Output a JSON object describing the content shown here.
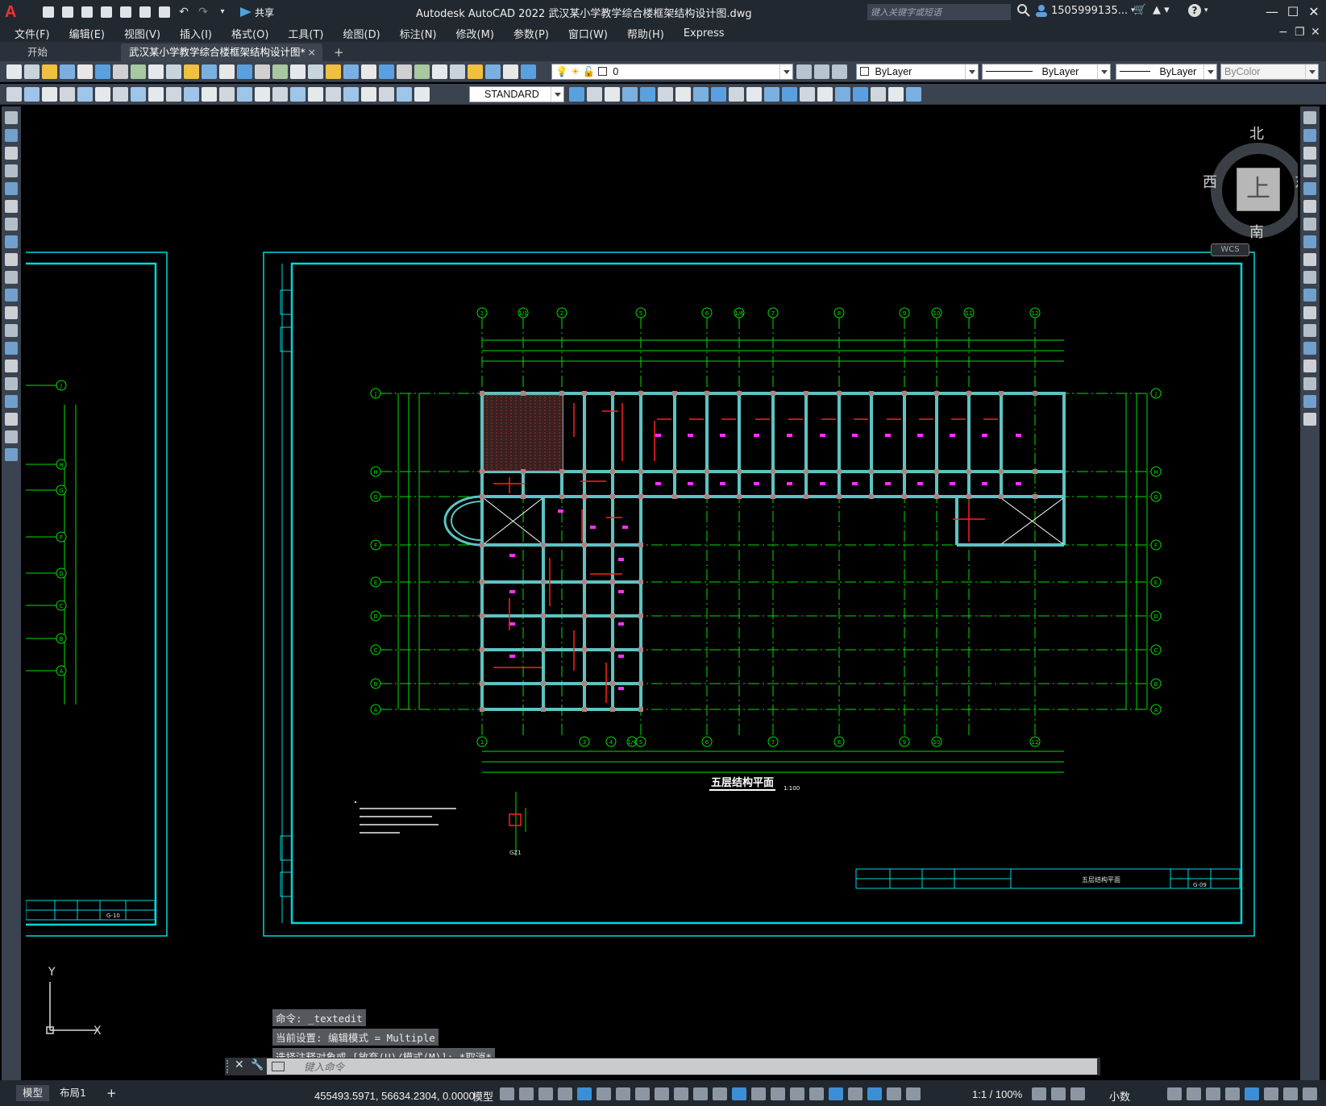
{
  "app": {
    "logo": "A",
    "title": "Autodesk AutoCAD 2022    武汉某小学教学综合楼框架结构设计图.dwg",
    "share_label": "共享",
    "search_placeholder": "键入关键字或短语",
    "user": "1505999135...",
    "help": "?"
  },
  "menu": [
    "文件(F)",
    "编辑(E)",
    "视图(V)",
    "插入(I)",
    "格式(O)",
    "工具(T)",
    "绘图(D)",
    "标注(N)",
    "修改(M)",
    "参数(P)",
    "窗口(W)",
    "帮助(H)",
    "Express"
  ],
  "tabs": {
    "start": "开始",
    "active": "武汉某小学教学综合楼框架结构设计图*",
    "close": "×",
    "add": "+"
  },
  "toolbar": {
    "layer_value": "0",
    "color": "ByLayer",
    "linetype": "ByLayer",
    "lineweight": "ByLayer",
    "plotstyle": "ByColor",
    "text_style": "STANDARD"
  },
  "viewcube": {
    "north": "北",
    "south": "南",
    "east": "东",
    "west": "西",
    "top_face": "上",
    "wcs": "WCS"
  },
  "drawing": {
    "plan_title": "五层结构平面",
    "scale": "1:100",
    "top_axes": [
      "1",
      "1/1",
      "2",
      "5",
      "6",
      "1/6",
      "7",
      "8",
      "9",
      "10",
      "11",
      "12"
    ],
    "bottom_axes": [
      "1",
      "3",
      "4",
      "1/4",
      "5",
      "6",
      "7",
      "8",
      "9",
      "10",
      "12"
    ],
    "row_axes": [
      "J",
      "H",
      "G",
      "F",
      "E",
      "D",
      "C",
      "B",
      "A"
    ],
    "left_sheet_axes": [
      "J",
      "H",
      "G",
      "F",
      "D",
      "C",
      "B",
      "A"
    ],
    "titleblock_name": "五层结构平面",
    "titleblock_no": "G-09",
    "left_titleblock_no": "G-10",
    "column_label": "GZ1"
  },
  "ucs": {
    "y": "Y",
    "x": "X"
  },
  "command": {
    "history": [
      "命令: _textedit",
      "当前设置: 编辑模式 = Multiple",
      "选择注释对象或 [放弃(U)/模式(M)]: *取消*"
    ],
    "placeholder": "键入命令"
  },
  "status": {
    "layout_tabs": [
      "模型",
      "布局1"
    ],
    "add_layout": "+",
    "coords": "455493.5971, 56634.2304, 0.0000",
    "model_label": "模型",
    "scale": "1:1 / 100%",
    "units": "小数"
  },
  "colors": {
    "titlebar_bg": "#222830",
    "toolbar_bg": "#3b4350",
    "canvas_bg": "#000000",
    "frame_cyan": "#00d8e0",
    "grid_green": "#00e000",
    "beam_teal": "#5ec3c3",
    "rebar_red": "#ff2020",
    "label_magenta": "#ff30ff",
    "accent_blue": "#3c8fd6"
  }
}
